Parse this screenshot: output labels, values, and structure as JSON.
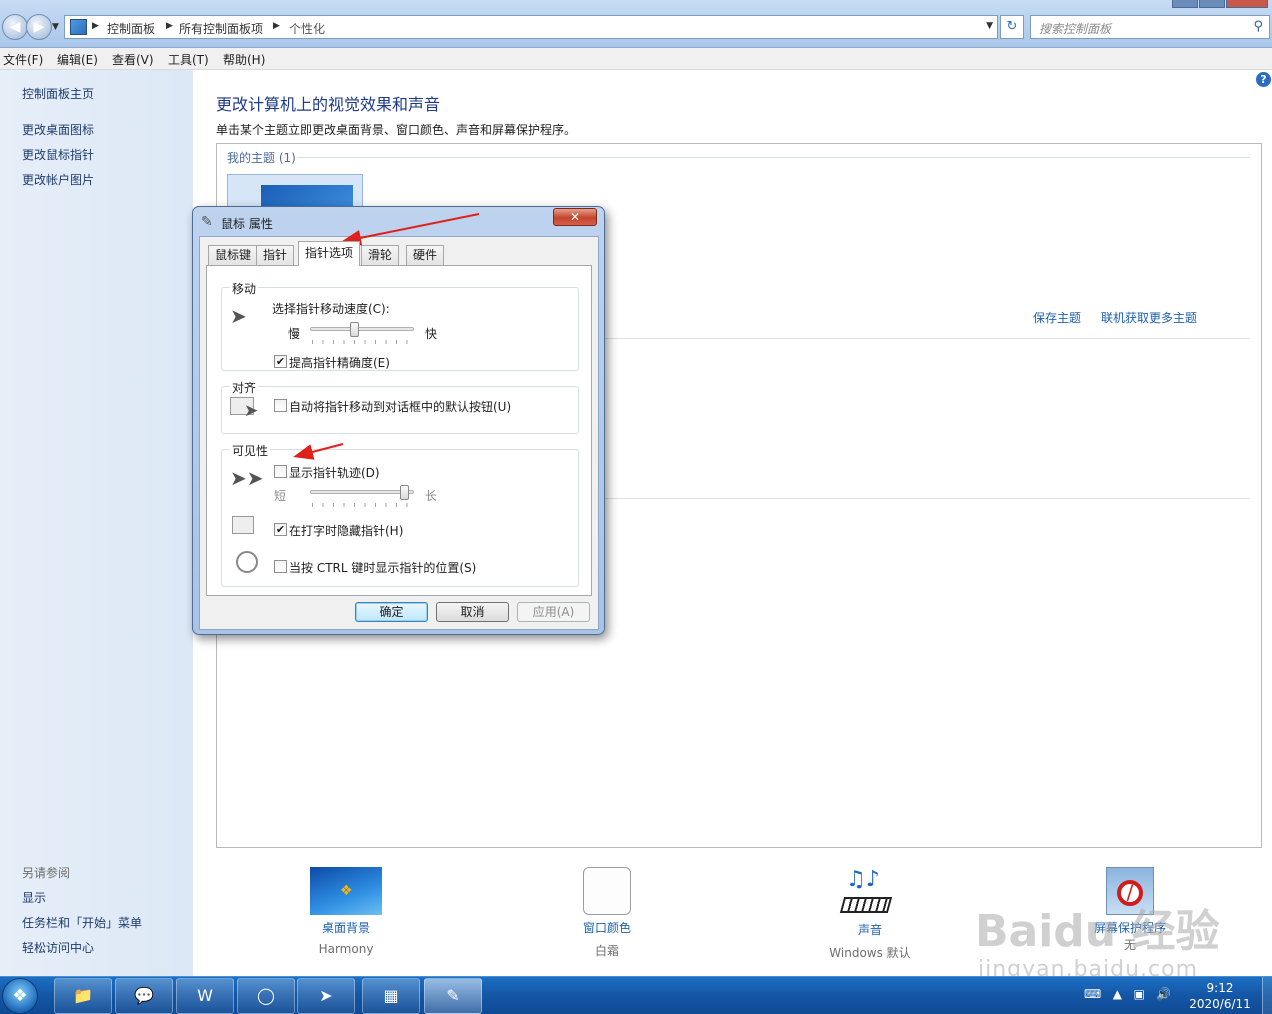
{
  "window": {
    "breadcrumb": [
      "控制面板",
      "所有控制面板项",
      "个性化"
    ],
    "search_placeholder": "搜索控制面板"
  },
  "menubar": [
    "文件(F)",
    "编辑(E)",
    "查看(V)",
    "工具(T)",
    "帮助(H)"
  ],
  "sidebar": {
    "home": "控制面板主页",
    "links": [
      "更改桌面图标",
      "更改鼠标指针",
      "更改帐户图片"
    ],
    "see_also_title": "另请参阅",
    "see_also": [
      "显示",
      "任务栏和「开始」菜单",
      "轻松访问中心"
    ]
  },
  "main": {
    "title": "更改计算机上的视觉效果和声音",
    "description": "单击某个主题立即更改桌面背景、窗口颜色、声音和屏幕保护程序。",
    "my_themes_label": "我的主题 (1)",
    "save_theme_link": "保存主题",
    "get_more_link": "联机获取更多主题",
    "bottom_items": [
      {
        "label": "桌面背景",
        "sub": "Harmony",
        "icon": "wallpaper-icon"
      },
      {
        "label": "窗口颜色",
        "sub": "白霜",
        "icon": "window-color-icon"
      },
      {
        "label": "声音",
        "sub": "Windows 默认",
        "icon": "sound-icon"
      },
      {
        "label": "屏幕保护程序",
        "sub": "无",
        "icon": "screensaver-icon"
      }
    ]
  },
  "dialog": {
    "title": "鼠标 属性",
    "tabs": [
      "鼠标键",
      "指针",
      "指针选项",
      "滑轮",
      "硬件"
    ],
    "active_tab": "指针选项",
    "groups": {
      "motion": {
        "title": "移动",
        "speed_label": "选择指针移动速度(C):",
        "slow": "慢",
        "fast": "快",
        "speed_level": 0.42,
        "precision_label": "提高指针精确度(E)",
        "precision_checked": true
      },
      "snap": {
        "title": "对齐",
        "snap_label": "自动将指针移动到对话框中的默认按钮(U)",
        "snap_checked": false
      },
      "visibility": {
        "title": "可见性",
        "trails_label": "显示指针轨迹(D)",
        "trails_checked": false,
        "short": "短",
        "long": "长",
        "trails_level": 0.95,
        "hide_label": "在打字时隐藏指针(H)",
        "hide_checked": true,
        "ctrl_label": "当按 CTRL 键时显示指针的位置(S)",
        "ctrl_checked": false
      }
    },
    "buttons": {
      "ok": "确定",
      "cancel": "取消",
      "apply": "应用(A)"
    }
  },
  "taskbar": {
    "time": "9:12",
    "date": "2020/6/11"
  },
  "watermark": {
    "main": "Baidu 经验",
    "sub": "jingyan.baidu.com"
  },
  "colors": {
    "link": "#1e60b0",
    "title": "#1e3a8a",
    "annotation_arrow": "#e0201a",
    "taskbar": "#1456a5"
  }
}
